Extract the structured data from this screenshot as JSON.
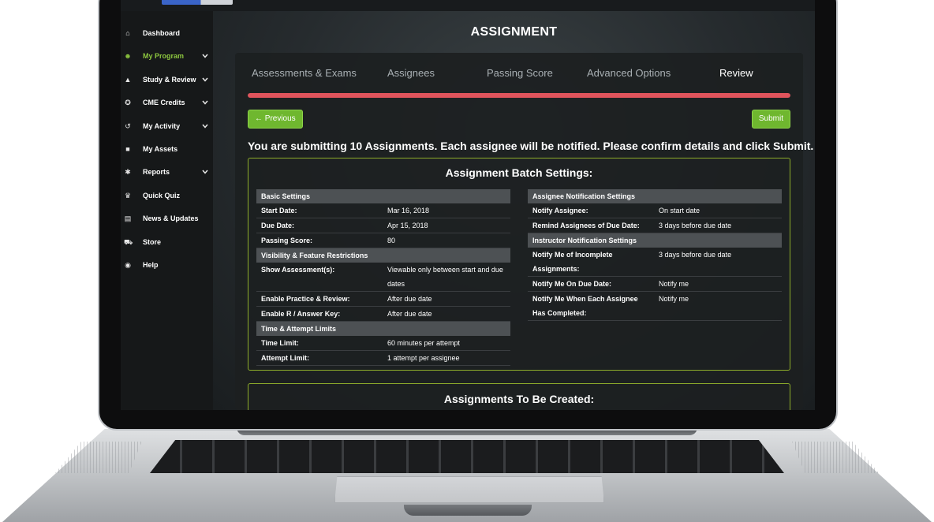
{
  "page": {
    "title": "ASSIGNMENT"
  },
  "sidebar": {
    "items": [
      {
        "label": "Dashboard",
        "icon": "home-icon",
        "chevron": false,
        "active": false
      },
      {
        "label": "My Program",
        "icon": "users-icon",
        "chevron": true,
        "active": true
      },
      {
        "label": "Study & Review",
        "icon": "graduation-cap-icon",
        "chevron": true,
        "active": false
      },
      {
        "label": "CME Credits",
        "icon": "certificate-icon",
        "chevron": true,
        "active": false
      },
      {
        "label": "My Activity",
        "icon": "history-icon",
        "chevron": true,
        "active": false
      },
      {
        "label": "My Assets",
        "icon": "book-icon",
        "chevron": false,
        "active": false
      },
      {
        "label": "Reports",
        "icon": "wrench-icon",
        "chevron": true,
        "active": false
      },
      {
        "label": "Quick Quiz",
        "icon": "trophy-icon",
        "chevron": false,
        "active": false
      },
      {
        "label": "News & Updates",
        "icon": "newspaper-icon",
        "chevron": false,
        "active": false
      },
      {
        "label": "Store",
        "icon": "cart-icon",
        "chevron": false,
        "active": false
      },
      {
        "label": "Help",
        "icon": "life-ring-icon",
        "chevron": false,
        "active": false
      }
    ]
  },
  "wizard": {
    "tabs": [
      "Assessments & Exams",
      "Assignees",
      "Passing Score",
      "Advanced Options",
      "Review"
    ],
    "current_tab": "Review",
    "progress_percent": 100,
    "previous_label": "← Previous",
    "submit_label": "Submit",
    "notice": "You are submitting 10 Assignments. Each assignee will be notified. Please confirm details and click Submit."
  },
  "batch": {
    "title": "Assignment Batch Settings:",
    "left_sections": [
      {
        "heading": "Basic Settings",
        "rows": [
          {
            "key": "Start Date:",
            "value": "Mar 16, 2018"
          },
          {
            "key": "Due Date:",
            "value": "Apr 15, 2018"
          },
          {
            "key": "Passing Score:",
            "value": "80"
          }
        ]
      },
      {
        "heading": "Visibility & Feature Restrictions",
        "rows": [
          {
            "key": "Show Assessment(s):",
            "value": "Viewable only between start and due dates"
          },
          {
            "key": "Enable Practice & Review:",
            "value": "After due date"
          },
          {
            "key": "Enable R / Answer Key:",
            "value": "After due date"
          }
        ]
      },
      {
        "heading": "Time & Attempt Limits",
        "rows": [
          {
            "key": "Time Limit:",
            "value": "60 minutes per attempt"
          },
          {
            "key": "Attempt Limit:",
            "value": "1 attempt per assignee"
          }
        ]
      }
    ],
    "right_sections": [
      {
        "heading": "Assignee Notification Settings",
        "rows": [
          {
            "key": "Notify Assignee:",
            "value": "On start date"
          },
          {
            "key": "Remind Assignees of Due Date:",
            "value": "3 days before due date"
          }
        ]
      },
      {
        "heading": "Instructor Notification Settings",
        "rows": [
          {
            "key": "Notify Me of Incomplete Assignments:",
            "value": "3 days before due date"
          },
          {
            "key": "Notify Me On Due Date:",
            "value": "Notify me"
          },
          {
            "key": "Notify Me When Each Assignee Has Completed:",
            "value": "Notify me"
          }
        ]
      }
    ]
  },
  "created": {
    "title": "Assignments To Be Created:"
  },
  "colors": {
    "accent": "#8dc63f",
    "button": "#6fb72f",
    "progress": "#e0545c",
    "border": "#8dac2a"
  }
}
